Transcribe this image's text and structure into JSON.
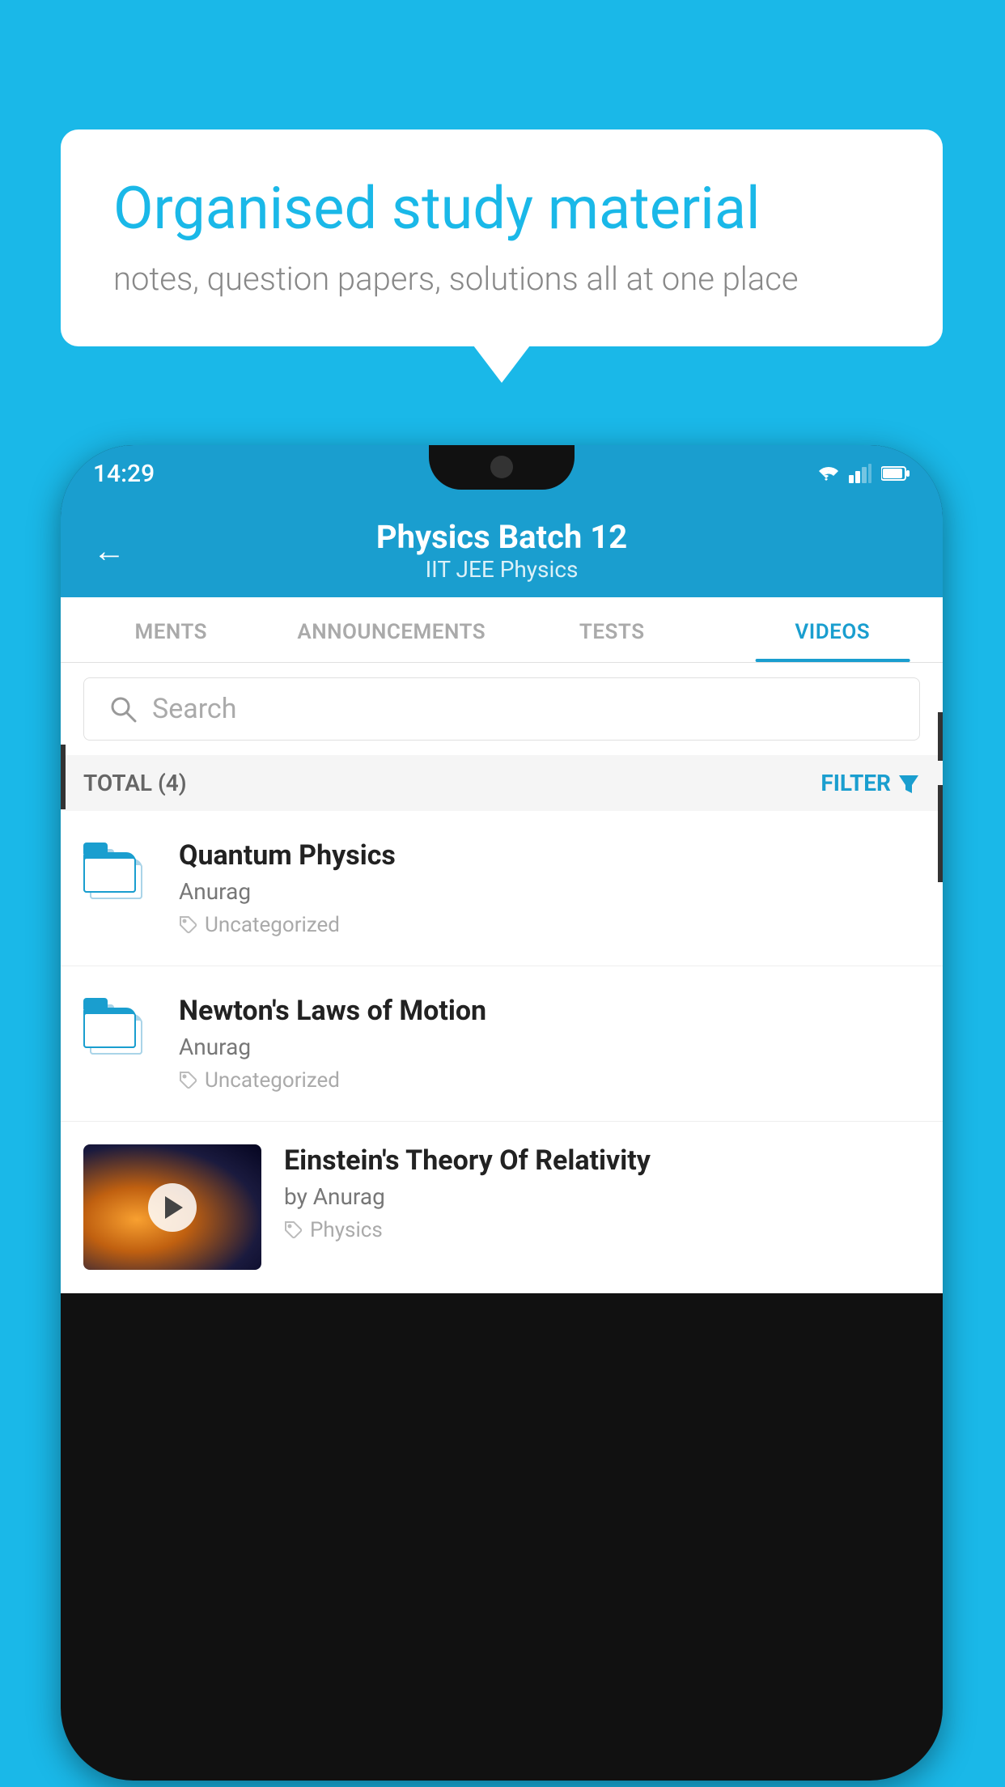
{
  "background_color": "#1ab8e8",
  "speech_bubble": {
    "title": "Organised study material",
    "subtitle": "notes, question papers, solutions all at one place"
  },
  "phone": {
    "status_bar": {
      "time": "14:29",
      "icons": [
        "wifi",
        "signal",
        "battery"
      ]
    },
    "header": {
      "back_label": "←",
      "title": "Physics Batch 12",
      "subtitle": "IIT JEE    Physics"
    },
    "tabs": [
      {
        "label": "MENTS",
        "active": false
      },
      {
        "label": "ANNOUNCEMENTS",
        "active": false
      },
      {
        "label": "TESTS",
        "active": false
      },
      {
        "label": "VIDEOS",
        "active": true
      }
    ],
    "search": {
      "placeholder": "Search"
    },
    "filter_bar": {
      "total_label": "TOTAL (4)",
      "filter_label": "FILTER"
    },
    "videos": [
      {
        "id": 1,
        "title": "Quantum Physics",
        "author": "Anurag",
        "tag": "Uncategorized",
        "has_thumbnail": false
      },
      {
        "id": 2,
        "title": "Newton's Laws of Motion",
        "author": "Anurag",
        "tag": "Uncategorized",
        "has_thumbnail": false
      },
      {
        "id": 3,
        "title": "Einstein's Theory Of Relativity",
        "author": "by Anurag",
        "tag": "Physics",
        "has_thumbnail": true
      }
    ]
  }
}
